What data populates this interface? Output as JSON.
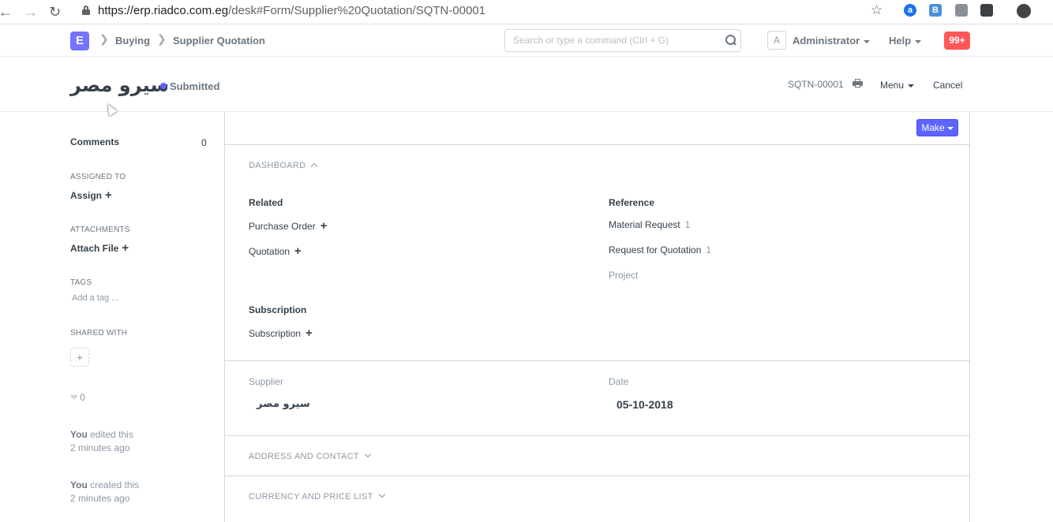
{
  "browser": {
    "url_host": "https://erp.riadco.com.eg",
    "url_path": "/desk#Form/Supplier%20Quotation/SQTN-00001",
    "extensions": [
      "a",
      "B",
      "",
      "",
      ""
    ]
  },
  "navbar": {
    "logo": "E",
    "breadcrumbs": [
      "Buying",
      "Supplier Quotation"
    ],
    "search_placeholder": "Search or type a command (Ctrl + G)",
    "avatar_letter": "A",
    "user": "Administrator",
    "help": "Help",
    "notifications": "99+"
  },
  "pagehead": {
    "title": "سيرو مصر",
    "status": "Submitted",
    "docname": "SQTN-00001",
    "menu": "Menu",
    "cancel": "Cancel"
  },
  "sidebar": {
    "comments_label": "Comments",
    "comments_count": "0",
    "assigned_to_label": "ASSIGNED TO",
    "assign": "Assign",
    "attachments_label": "ATTACHMENTS",
    "attach_file": "Attach File",
    "tags_label": "TAGS",
    "add_tag": "Add a tag ...",
    "shared_with_label": "SHARED WITH",
    "likes": "0",
    "activity": [
      {
        "who": "You",
        "what": "edited this",
        "when": "2 minutes ago"
      },
      {
        "who": "You",
        "what": "created this",
        "when": "2 minutes ago"
      }
    ]
  },
  "form": {
    "make": "Make",
    "dashboard_label": "DASHBOARD",
    "related_title": "Related",
    "related_items": [
      {
        "label": "Purchase Order"
      },
      {
        "label": "Quotation"
      }
    ],
    "reference_title": "Reference",
    "reference_items": [
      {
        "label": "Material Request",
        "count": "1"
      },
      {
        "label": "Request for Quotation",
        "count": "1"
      },
      {
        "label": "Project",
        "count": ""
      }
    ],
    "subscription_title": "Subscription",
    "subscription_item": "Subscription",
    "supplier_label": "Supplier",
    "supplier_value": "سيرو مصر",
    "date_label": "Date",
    "date_value": "05-10-2018",
    "address_section": "ADDRESS AND CONTACT",
    "currency_section": "CURRENCY AND PRICE LIST"
  },
  "colors": {
    "accent": "#5e64ff",
    "notification": "#ff5858",
    "logo": "#7574ff"
  }
}
